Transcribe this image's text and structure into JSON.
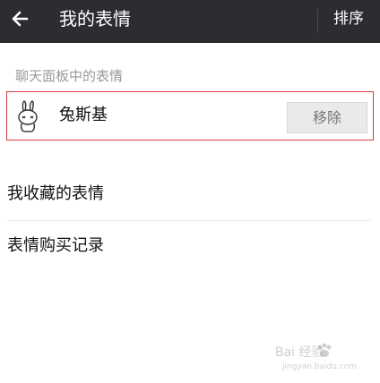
{
  "header": {
    "title": "我的表情",
    "sort_label": "排序"
  },
  "chat_panel": {
    "section_label": "聊天面板中的表情",
    "items": [
      {
        "name": "兔斯基",
        "remove_label": "移除"
      }
    ]
  },
  "menu": {
    "items": [
      {
        "label": "我收藏的表情"
      },
      {
        "label": "表情购买记录"
      }
    ]
  },
  "watermark": {
    "text": "Bai  经验",
    "url": "jingyan.baidu.com"
  },
  "colors": {
    "header_bg": "#2b2d31",
    "highlight_border": "#d23b3b"
  }
}
